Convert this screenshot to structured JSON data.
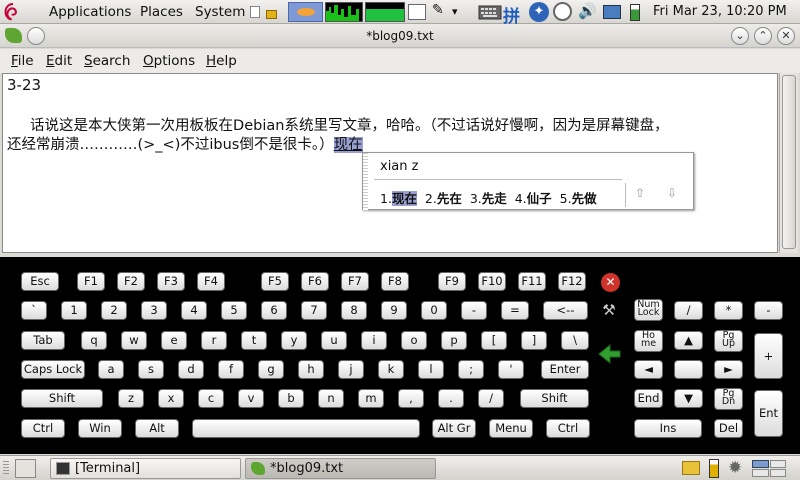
{
  "top_panel": {
    "menus": [
      "Applications",
      "Places",
      "System"
    ],
    "clock": "Fri Mar 23, 10:20 PM",
    "ime_glyph": "拼",
    "icons": [
      "debian-logo-icon",
      "notes-icon",
      "lock-icon",
      "network-monitor-icon",
      "cpu-monitor-icon",
      "memory-monitor-icon",
      "image-viewer-icon",
      "edit-icon",
      "chevron-down-icon",
      "keyboard-icon",
      "ime-pinyin-icon",
      "accessibility-icon",
      "clock-icon",
      "volume-icon",
      "network-icon",
      "battery-icon"
    ]
  },
  "window": {
    "title": "*blog09.txt",
    "menu": [
      {
        "label": "File",
        "mnemonic": "F",
        "rest": "ile"
      },
      {
        "label": "Edit",
        "mnemonic": "E",
        "rest": "dit"
      },
      {
        "label": "Search",
        "mnemonic": "S",
        "rest": "earch"
      },
      {
        "label": "Options",
        "mnemonic": "O",
        "rest": "ptions"
      },
      {
        "label": "Help",
        "mnemonic": "H",
        "rest": "elp"
      }
    ]
  },
  "editor": {
    "line1": "3-23",
    "line2": "     话说这是本大侠第一次用板板在Debian系统里写文章，哈哈。（不过话说好慢啊，因为是屏幕键盘，",
    "line3": "还经常崩溃…………(>_<)不过ibus倒不是很卡。）",
    "preedit": "现在"
  },
  "ime": {
    "input": "xian z",
    "candidates": [
      {
        "index": "1.",
        "text": "现在",
        "selected": true
      },
      {
        "index": "2.",
        "text": "先在"
      },
      {
        "index": "3.",
        "text": "先走"
      },
      {
        "index": "4.",
        "text": "仙子"
      },
      {
        "index": "5.",
        "text": "先做"
      }
    ]
  },
  "keyboard": {
    "row0": [
      "Esc",
      "F1",
      "F2",
      "F3",
      "F4",
      "F5",
      "F6",
      "F7",
      "F8",
      "F9",
      "F10",
      "F11",
      "F12"
    ],
    "row1": [
      "`",
      "1",
      "2",
      "3",
      "4",
      "5",
      "6",
      "7",
      "8",
      "9",
      "0",
      "-",
      "=",
      "<--"
    ],
    "row2": [
      "Tab",
      "q",
      "w",
      "e",
      "r",
      "t",
      "y",
      "u",
      "i",
      "o",
      "p",
      "[",
      "]",
      "\\"
    ],
    "row3": [
      "Caps Lock",
      "a",
      "s",
      "d",
      "f",
      "g",
      "h",
      "j",
      "k",
      "l",
      ";",
      "'",
      "Enter"
    ],
    "row4": [
      "Shift",
      "z",
      "x",
      "c",
      "v",
      "b",
      "n",
      "m",
      ",",
      ".",
      "/",
      "Shift"
    ],
    "row5": [
      "Ctrl",
      "Win",
      "Alt",
      "",
      "Alt Gr",
      "Menu",
      "Ctrl"
    ],
    "numlock": [
      "Num",
      "Lock"
    ],
    "slash": "/",
    "star": "*",
    "minus": "-",
    "home": [
      "Ho",
      "me"
    ],
    "up": "▲",
    "pgup": [
      "Pg",
      "Up"
    ],
    "left": "◄",
    "right": "►",
    "end": "End",
    "down": "▼",
    "pgdn": [
      "Pg",
      "Dn"
    ],
    "ins": "Ins",
    "del": "Del",
    "plus": "+",
    "ent": "Ent"
  },
  "bottom_panel": {
    "tasks": [
      "[Terminal]",
      "*blog09.txt"
    ]
  },
  "colors": {
    "accent": "#98a0d2",
    "close_red": "#d0332c",
    "arrow_green": "#2f9e2f"
  }
}
